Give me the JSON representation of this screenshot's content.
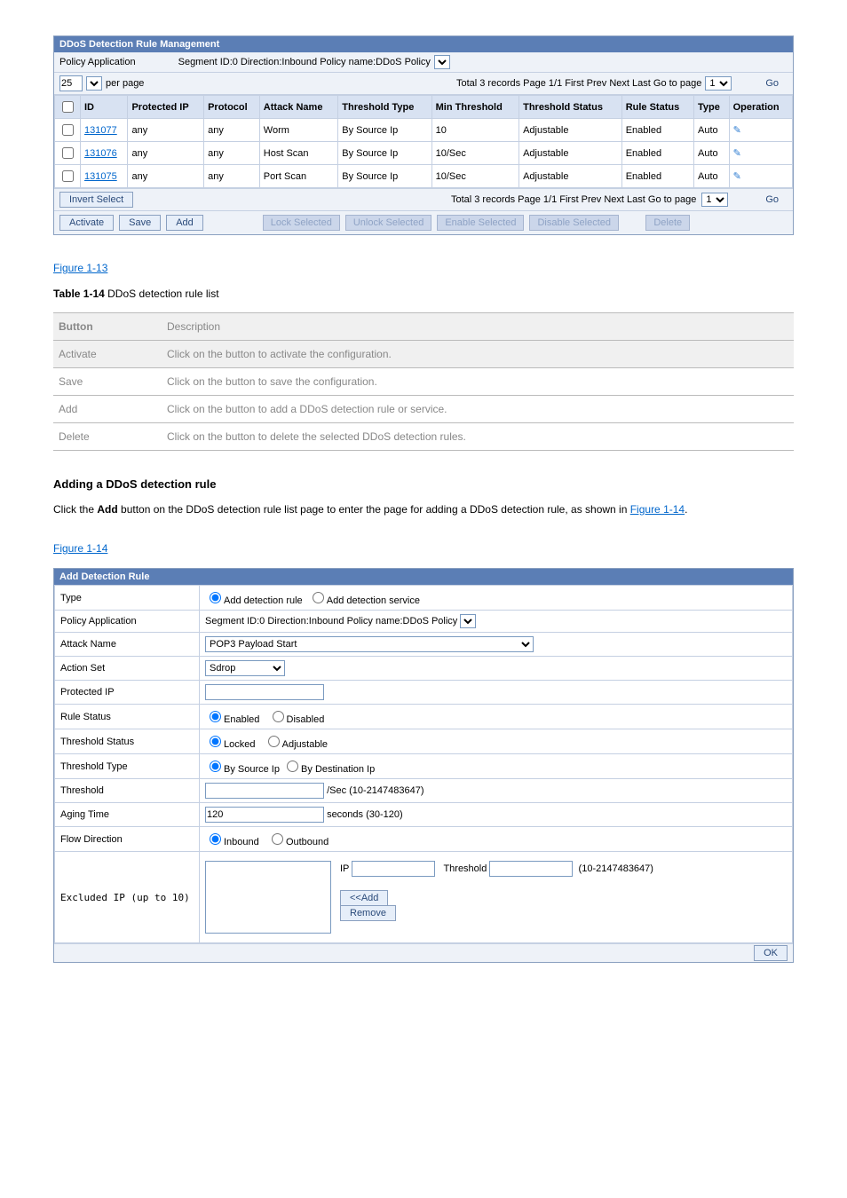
{
  "fig1": {
    "title": "DDoS Detection Rule Management",
    "policyApp": "Policy Application",
    "segTxt": "Segment ID:0  Direction:Inbound  Policy name:DDoS Policy",
    "perPageVal": "25",
    "perPage": "per page",
    "total": "Total 3 records    Page 1/1    First Prev Next Last    Go to page",
    "go": "Go",
    "invert": "Invert Select",
    "gobottom": "Go",
    "headers": {
      "id": "ID",
      "pip": "Protected IP",
      "proto": "Protocol",
      "atk": "Attack Name",
      "thtype": "Threshold Type",
      "minth": "Min Threshold",
      "thstat": "Threshold Status",
      "rstat": "Rule Status",
      "type": "Type",
      "op": "Operation"
    },
    "rows": [
      {
        "id": "131077",
        "pip": "any",
        "proto": "any",
        "atk": "Worm",
        "thtype": "By Source Ip",
        "min": "10",
        "thstat": "Adjustable",
        "rstat": "Enabled",
        "type": "Auto"
      },
      {
        "id": "131076",
        "pip": "any",
        "proto": "any",
        "atk": "Host Scan",
        "thtype": "By Source Ip",
        "min": "10/Sec",
        "thstat": "Adjustable",
        "rstat": "Enabled",
        "type": "Auto"
      },
      {
        "id": "131075",
        "pip": "any",
        "proto": "any",
        "atk": "Port Scan",
        "thtype": "By Source Ip",
        "min": "10/Sec",
        "thstat": "Adjustable",
        "rstat": "Enabled",
        "type": "Auto"
      }
    ],
    "btns": {
      "activate": "Activate",
      "save": "Save",
      "add": "Add",
      "lock": "Lock Selected",
      "unlock": "Unlock Selected",
      "enable": "Enable Selected",
      "disable": "Disable Selected",
      "delete": "Delete"
    }
  },
  "fig1label": "Figure 1-13 ",
  "table14": {
    "caption": "Table 1-14 ",
    "capsuf": "DDoS detection rule list",
    "h1": "Button",
    "h2": "Description",
    "rows": [
      {
        "a": "Activate",
        "b": "Click on the button to activate the configuration."
      },
      {
        "a": "Save",
        "b": "Click on the button to save the configuration."
      },
      {
        "a": "Add",
        "b": "Click on the button to add a DDoS detection rule or service."
      },
      {
        "a": "Delete",
        "b": "Click on the button to delete the selected DDoS detection rules."
      }
    ]
  },
  "heading": "Adding a DDoS detection rule",
  "para": {
    "p1a": "Click the ",
    "p1b": "Add",
    "p1c": " button on the DDoS detection rule list page to enter the page for adding a DDoS detection rule, as shown in ",
    "p1d": "Figure 1-14",
    "p1e": "."
  },
  "fig2label": "Figure 1-14 ",
  "add": {
    "title": "Add Detection Rule",
    "type": "Type",
    "addrule": "Add detection rule",
    "addsvc": "Add detection service",
    "policyApp": "Policy Application",
    "segTxt": "Segment ID:0  Direction:Inbound  Policy name:DDoS Policy",
    "atkname": "Attack Name",
    "atkval": "POP3 Payload Start",
    "actionset": "Action Set",
    "actionval": "Sdrop",
    "pip": "Protected IP",
    "rstat": "Rule Status",
    "enabled": "Enabled",
    "disabled": "Disabled",
    "thstat": "Threshold Status",
    "locked": "Locked",
    "adj": "Adjustable",
    "thtype": "Threshold Type",
    "bysrc": "By Source Ip",
    "bydst": "By Destination Ip",
    "threshold": "Threshold",
    "thhint": "/Sec  (10-2147483647)",
    "aging": "Aging Time",
    "agingval": "120",
    "aginghint": "seconds  (30-120)",
    "flow": "Flow Direction",
    "inbound": "Inbound",
    "outbound": "Outbound",
    "excl": "Excluded IP (up to 10)",
    "ip": "IP",
    "thlabel": "Threshold",
    "range": "(10-2147483647)",
    "addbtn": "<<Add",
    "remove": "Remove",
    "ok": "OK"
  }
}
